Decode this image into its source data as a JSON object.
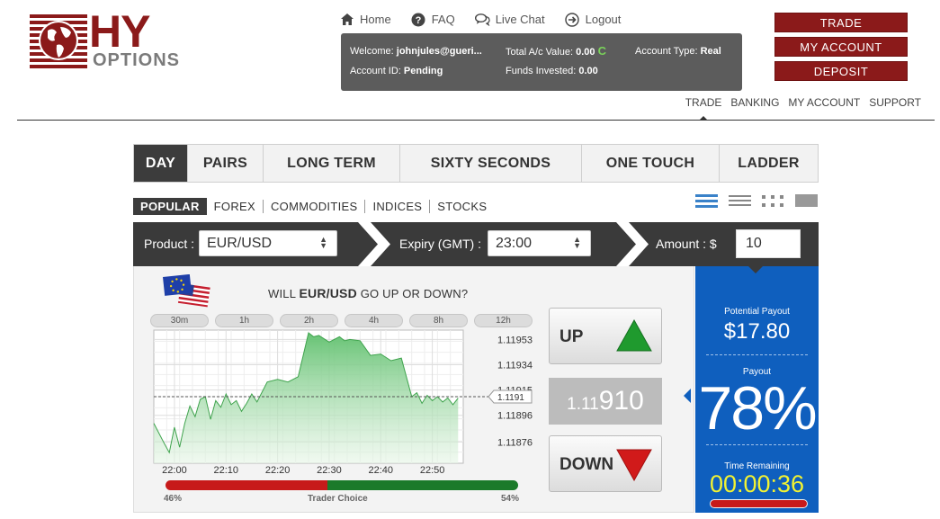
{
  "header": {
    "logo_main": "HY",
    "logo_sub": "OPTIONS",
    "nav": [
      {
        "label": "Home",
        "icon": "home-icon"
      },
      {
        "label": "FAQ",
        "icon": "question-icon"
      },
      {
        "label": "Live Chat",
        "icon": "chat-icon"
      },
      {
        "label": "Logout",
        "icon": "logout-icon"
      }
    ],
    "buttons": [
      "TRADE",
      "MY ACCOUNT",
      "DEPOSIT"
    ],
    "subnav": [
      "TRADE",
      "BANKING",
      "MY ACCOUNT",
      "SUPPORT"
    ]
  },
  "account": {
    "welcome_label": "Welcome:",
    "welcome_value": "johnjules@gueri...",
    "total_label": "Total A/c Value:",
    "total_value": "0.00",
    "type_label": "Account Type:",
    "type_value": "Real",
    "id_label": "Account ID:",
    "id_value": "Pending",
    "funds_label": "Funds Invested:",
    "funds_value": "0.00"
  },
  "tabs": [
    {
      "label": "DAY",
      "active": true
    },
    {
      "label": "PAIRS"
    },
    {
      "label": "LONG TERM"
    },
    {
      "label": "SIXTY SECONDS"
    },
    {
      "label": "ONE TOUCH"
    },
    {
      "label": "LADDER"
    }
  ],
  "categories": [
    {
      "label": "POPULAR",
      "active": true
    },
    {
      "label": "FOREX"
    },
    {
      "label": "COMMODITIES"
    },
    {
      "label": "INDICES"
    },
    {
      "label": "STOCKS"
    }
  ],
  "trade_bar": {
    "product_label": "Product :",
    "product_value": "EUR/USD",
    "expiry_label": "Expiry (GMT) :",
    "expiry_value": "23:00",
    "amount_label": "Amount : $",
    "amount_value": "10"
  },
  "question": {
    "prefix": "WILL",
    "asset": "EUR/USD",
    "suffix": "GO UP OR DOWN?"
  },
  "timeframes": [
    "30m",
    "1h",
    "2h",
    "4h",
    "8h",
    "12h"
  ],
  "chart_data": {
    "type": "area",
    "x_ticks": [
      "22:00",
      "22:10",
      "22:20",
      "22:30",
      "22:40",
      "22:50"
    ],
    "y_ticks": [
      1.11953,
      1.11934,
      1.11915,
      1.11896,
      1.11876
    ],
    "current_label": "1.1191",
    "ylim": [
      1.1186,
      1.1196
    ],
    "xlim": [
      0,
      60
    ],
    "x": [
      0,
      2,
      3,
      4,
      5,
      6,
      7,
      8,
      9,
      10,
      11,
      12,
      13,
      14,
      15,
      16,
      17,
      18,
      19,
      20,
      22,
      24,
      26,
      28,
      30,
      31,
      32,
      34,
      36,
      37,
      38,
      40,
      42,
      44,
      46,
      48,
      50,
      51,
      52,
      53,
      54,
      55,
      56,
      57,
      58,
      59
    ],
    "y": [
      1.1189,
      1.11875,
      1.11868,
      1.11887,
      1.11872,
      1.1189,
      1.11903,
      1.11895,
      1.11908,
      1.1191,
      1.11893,
      1.11907,
      1.11902,
      1.11912,
      1.11904,
      1.11907,
      1.11899,
      1.11905,
      1.11912,
      1.11906,
      1.11921,
      1.11923,
      1.11921,
      1.11925,
      1.11958,
      1.11955,
      1.11956,
      1.11951,
      1.11955,
      1.11952,
      1.11953,
      1.11952,
      1.11941,
      1.11942,
      1.11937,
      1.11939,
      1.1191,
      1.11913,
      1.11905,
      1.11911,
      1.11907,
      1.1191,
      1.11906,
      1.11909,
      1.11904,
      1.11909
    ],
    "baseline": 1.1191
  },
  "trader_choice": {
    "label": "Trader Choice",
    "down_pct": 46,
    "up_pct": 54,
    "down_label": "46%",
    "up_label": "54%"
  },
  "actions": {
    "up": "UP",
    "down": "DOWN",
    "price_prefix": "1.11",
    "price_main": "910"
  },
  "payout_panel": {
    "potential_label": "Potential Payout",
    "potential_value": "$17.80",
    "payout_label": "Payout",
    "payout_value": "78%",
    "time_label": "Time Remaining",
    "time_value": "00:00:36"
  },
  "colors": {
    "brand": "#8b1a1a",
    "panel_blue": "#0f5fbe",
    "up_green": "#1f9a2e",
    "down_red": "#d11a1a",
    "timer_yellow": "#f2f232"
  }
}
